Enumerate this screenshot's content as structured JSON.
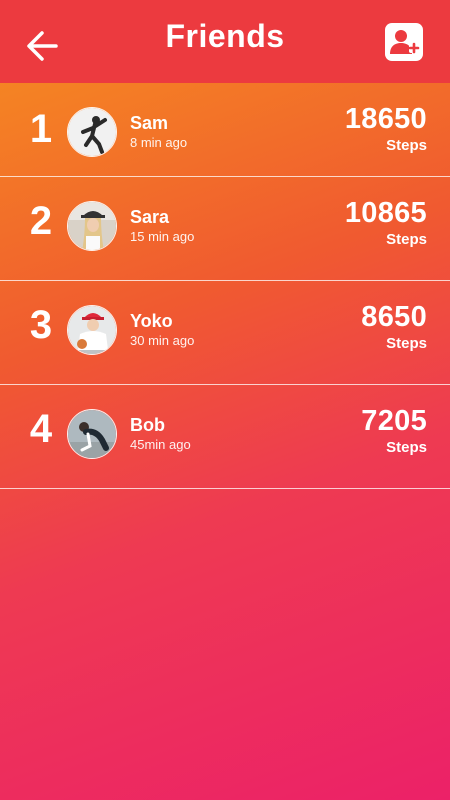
{
  "header": {
    "title": "Friends",
    "back_icon": "arrow-left-icon",
    "add_icon": "add-user-icon"
  },
  "colors": {
    "header_bg": "#ec3a3f",
    "gradient_start": "#f6901f",
    "gradient_end": "#ec2168",
    "text": "#ffffff"
  },
  "friends": [
    {
      "rank": "1",
      "name": "Sam",
      "time": "8 min ago",
      "steps": "18650",
      "steps_label": "Steps"
    },
    {
      "rank": "2",
      "name": "Sara",
      "time": "15 min ago",
      "steps": "10865",
      "steps_label": "Steps"
    },
    {
      "rank": "3",
      "name": "Yoko",
      "time": "30 min ago",
      "steps": "8650",
      "steps_label": "Steps"
    },
    {
      "rank": "4",
      "name": "Bob",
      "time": "45min ago",
      "steps": "7205",
      "steps_label": "Steps"
    }
  ]
}
